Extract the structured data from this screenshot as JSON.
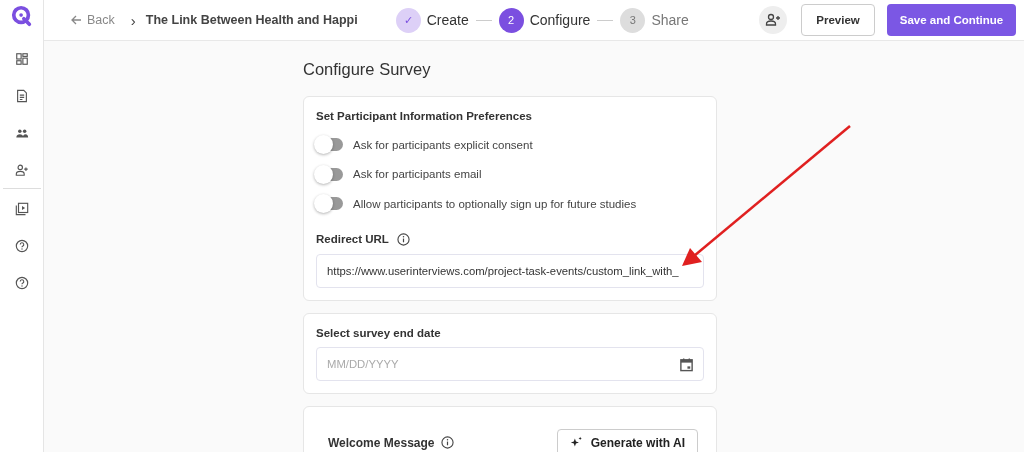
{
  "header": {
    "back": "Back",
    "breadcrumb_separator": "›",
    "project_title": "The Link Between Health and Happi",
    "steps": [
      {
        "number": "✓",
        "label": "Create",
        "done": true,
        "selected": false
      },
      {
        "number": "2",
        "label": "Configure",
        "done": false,
        "selected": true
      },
      {
        "number": "3",
        "label": "Share",
        "done": false,
        "selected": false
      }
    ],
    "buttons": {
      "preview": "Preview",
      "save": "Save and Continue"
    }
  },
  "page_title": "Configure Survey",
  "participant_card": {
    "title": "Set Participant Information Preferences",
    "toggles": [
      {
        "label": "Ask for participants explicit consent",
        "checked": false
      },
      {
        "label": "Ask for participants email",
        "checked": false
      },
      {
        "label": "Allow participants to optionally sign up for future studies",
        "checked": false
      }
    ],
    "redirect_label": "Redirect URL",
    "redirect_value": "https://www.userinterviews.com/project-task-events/custom_link_with_"
  },
  "end_date_card": {
    "title": "Select survey end date",
    "placeholder": "MM/DD/YYYY"
  },
  "welcome_card": {
    "title": "Welcome Message",
    "generate_button": "Generate with AI"
  }
}
